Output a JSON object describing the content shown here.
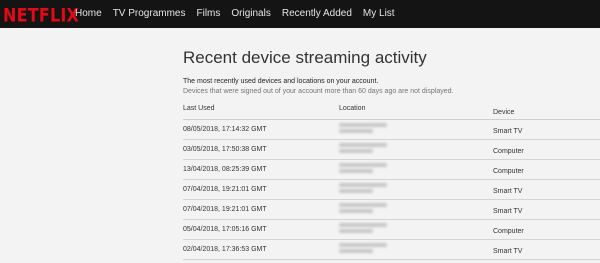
{
  "brand": {
    "logo_text": "NETFLIX",
    "logo_color": "#e50914",
    "nav_bg": "#141414"
  },
  "nav": [
    "Home",
    "TV Programmes",
    "Films",
    "Originals",
    "Recently Added",
    "My List"
  ],
  "page": {
    "title": "Recent device streaming activity",
    "intro": "The most recently used devices and locations on your account.",
    "intro_sub": "Devices that were signed out of your account more than 60 days ago are not displayed."
  },
  "table": {
    "headers": [
      "Last Used",
      "Location",
      "Device"
    ],
    "rows": [
      {
        "last_used": "08/05/2018, 17:14:32 GMT",
        "location": "",
        "device": "Smart TV"
      },
      {
        "last_used": "03/05/2018, 17:50:38 GMT",
        "location": "",
        "device": "Computer"
      },
      {
        "last_used": "13/04/2018, 08:25:39 GMT",
        "location": "",
        "device": "Computer"
      },
      {
        "last_used": "07/04/2018, 19:21:01 GMT",
        "location": "",
        "device": "Smart TV"
      },
      {
        "last_used": "07/04/2018, 19:21:01 GMT",
        "location": "",
        "device": "Smart TV"
      },
      {
        "last_used": "05/04/2018, 17:05:16 GMT",
        "location": "",
        "device": "Computer"
      },
      {
        "last_used": "02/04/2018, 17:36:53 GMT",
        "location": "",
        "device": "Smart TV"
      }
    ]
  }
}
